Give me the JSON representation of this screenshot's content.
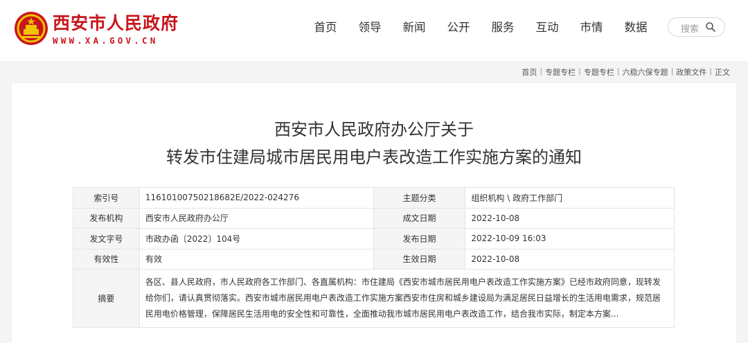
{
  "header": {
    "site_name": "西安市人民政府",
    "site_url": "WWW.XA.GOV.CN",
    "nav": [
      "首页",
      "领导",
      "新闻",
      "公开",
      "服务",
      "互动",
      "市情",
      "数据"
    ],
    "search_placeholder": "搜索"
  },
  "breadcrumb": [
    "首页",
    "专题专栏",
    "专题专栏",
    "六稳六保专题",
    "政策文件",
    "正文"
  ],
  "article": {
    "title_line1": "西安市人民政府办公厅关于",
    "title_line2": "转发市住建局城市居民用电户表改造工作实施方案的通知"
  },
  "info": {
    "index_label": "索引号",
    "index_value": "11610100750218682E/2022-024276",
    "topic_label": "主题分类",
    "topic_value": "组织机构 \\ 政府工作部门",
    "issuer_label": "发布机构",
    "issuer_value": "西安市人民政府办公厅",
    "created_label": "成文日期",
    "created_value": "2022-10-08",
    "docno_label": "发文字号",
    "docno_value": "市政办函〔2022〕104号",
    "published_label": "发布日期",
    "published_value": "2022-10-09 16:03",
    "validity_label": "有效性",
    "validity_value": "有效",
    "effective_label": "生效日期",
    "effective_value": "2022-10-08",
    "abstract_label": "摘要",
    "abstract_value": "各区、县人民政府，市人民政府各工作部门、各直属机构：市住建局《西安市城市居民用电户表改造工作实施方案》已经市政府同意，现转发给你们，请认真贯彻落实。西安市城市居民用电户表改造工作实施方案西安市住房和城乡建设局为满足居民日益增长的生活用电需求，规范居民用电价格管理，保障居民生活用电的安全性和可靠性，全面推动我市城市居民用电户表改造工作，结合我市实际，制定本方案..."
  }
}
